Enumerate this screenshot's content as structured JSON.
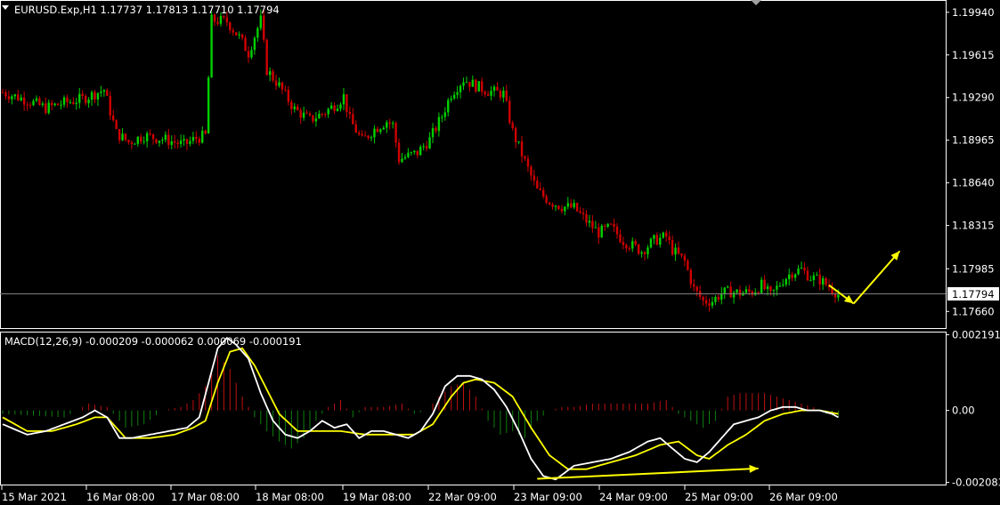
{
  "chart_data": [
    {
      "type": "candlestick",
      "title": "EURUSD.Exp,H1  1.17737 1.17813 1.17710 1.17794",
      "ylim": [
        1.1754,
        1.2002
      ],
      "y_ticks": [
        "1.19940",
        "1.19615",
        "1.19290",
        "1.18965",
        "1.18640",
        "1.18315",
        "1.17985",
        "1.17660"
      ],
      "current_price": "1.17794",
      "bull_color": "#00d000",
      "bear_color": "#d00000",
      "bars": 195,
      "path_anchors": [
        [
          0,
          1.1933
        ],
        [
          8,
          1.1927
        ],
        [
          14,
          1.1921
        ],
        [
          20,
          1.1925
        ],
        [
          26,
          1.1928
        ],
        [
          30,
          1.1932
        ],
        [
          33,
          1.1935
        ],
        [
          37,
          1.1902
        ],
        [
          41,
          1.1895
        ],
        [
          46,
          1.19
        ],
        [
          53,
          1.1897
        ],
        [
          59,
          1.1893
        ],
        [
          63,
          1.1898
        ],
        [
          66,
          1.19
        ],
        [
          68,
          1.1988
        ],
        [
          73,
          1.1987
        ],
        [
          77,
          1.1975
        ],
        [
          80,
          1.1963
        ],
        [
          82,
          1.1976
        ],
        [
          84,
          1.1988
        ],
        [
          86,
          1.195
        ],
        [
          90,
          1.1938
        ],
        [
          95,
          1.192
        ],
        [
          100,
          1.1912
        ],
        [
          105,
          1.1918
        ],
        [
          109,
          1.1925
        ],
        [
          111,
          1.193
        ],
        [
          113,
          1.1912
        ],
        [
          117,
          1.1896
        ],
        [
          121,
          1.1905
        ],
        [
          125,
          1.1911
        ],
        [
          127,
          1.1908
        ],
        [
          129,
          1.1882
        ],
        [
          135,
          1.1887
        ],
        [
          139,
          1.1897
        ],
        [
          143,
          1.1915
        ],
        [
          146,
          1.1932
        ],
        [
          150,
          1.1943
        ],
        [
          154,
          1.1938
        ],
        [
          158,
          1.1934
        ],
        [
          163,
          1.1932
        ],
        [
          166,
          1.1903
        ],
        [
          170,
          1.188
        ],
        [
          174,
          1.1858
        ],
        [
          178,
          1.185
        ],
        [
          182,
          1.1846
        ],
        [
          186,
          1.1845
        ],
        [
          190,
          1.1835
        ],
        [
          194,
          1.1826
        ],
        [
          198,
          1.183
        ],
        [
          202,
          1.182
        ],
        [
          208,
          1.1812
        ],
        [
          212,
          1.182
        ],
        [
          216,
          1.1823
        ],
        [
          218,
          1.1813
        ],
        [
          222,
          1.1804
        ],
        [
          225,
          1.1783
        ],
        [
          228,
          1.1774
        ],
        [
          231,
          1.1774
        ],
        [
          234,
          1.178
        ],
        [
          237,
          1.1781
        ],
        [
          240,
          1.178
        ],
        [
          244,
          1.1781
        ],
        [
          247,
          1.1786
        ],
        [
          250,
          1.1778
        ],
        [
          254,
          1.179
        ],
        [
          257,
          1.1796
        ],
        [
          260,
          1.1798
        ],
        [
          263,
          1.1792
        ],
        [
          266,
          1.179
        ],
        [
          269,
          1.1785
        ],
        [
          272,
          1.1779
        ]
      ],
      "annotation_arrows": [
        {
          "from": [
            1.1786,
            "26 Mar 09:00"
          ],
          "to": [
            1.1772,
            "end"
          ],
          "color": "#ffff00"
        },
        {
          "from": [
            1.1772,
            "end"
          ],
          "to": [
            1.1812,
            "future"
          ],
          "color": "#ffff00"
        }
      ]
    },
    {
      "type": "macd",
      "title": "MACD(12,26,9) -0.000209 -0.000062 0.000069 -0.000191",
      "ylim": [
        -0.00212,
        0.00223
      ],
      "y_ticks": [
        "0.002191",
        "0.00",
        "-0.002083"
      ],
      "macd_color": "#ffffff",
      "signal_color": "#ffff00",
      "hist_pos_color": "#c01010",
      "hist_neg_color": "#108010",
      "histogram_anchors": [
        [
          0,
          -0.0001
        ],
        [
          20,
          -0.0002
        ],
        [
          28,
          0.0002
        ],
        [
          34,
          0.0001
        ],
        [
          40,
          -0.0005
        ],
        [
          46,
          -0.0004
        ],
        [
          52,
          0.0
        ],
        [
          58,
          0.0001
        ],
        [
          62,
          0.0003
        ],
        [
          66,
          0.0007
        ],
        [
          70,
          0.0016
        ],
        [
          74,
          0.0012
        ],
        [
          78,
          0.0004
        ],
        [
          82,
          -0.0002
        ],
        [
          86,
          -0.0006
        ],
        [
          90,
          -0.0009
        ],
        [
          94,
          -0.0011
        ],
        [
          98,
          -0.0008
        ],
        [
          102,
          -0.0003
        ],
        [
          106,
          0.0001
        ],
        [
          110,
          0.0003
        ],
        [
          114,
          -0.0002
        ],
        [
          118,
          0.0001
        ],
        [
          124,
          0.0001
        ],
        [
          130,
          0.0002
        ],
        [
          134,
          -0.0001
        ],
        [
          138,
          0.0
        ],
        [
          142,
          0.0004
        ],
        [
          146,
          0.0007
        ],
        [
          150,
          0.0008
        ],
        [
          154,
          0.0004
        ],
        [
          158,
          -0.0003
        ],
        [
          162,
          -0.0007
        ],
        [
          166,
          -0.0006
        ],
        [
          170,
          -0.0008
        ],
        [
          174,
          -0.0003
        ],
        [
          178,
          0.0
        ],
        [
          182,
          0.0001
        ],
        [
          186,
          0.0001
        ],
        [
          192,
          0.0002
        ],
        [
          198,
          0.0002
        ],
        [
          204,
          0.0002
        ],
        [
          210,
          0.0002
        ],
        [
          216,
          0.0003
        ],
        [
          220,
          -0.0001
        ],
        [
          224,
          -0.0003
        ],
        [
          228,
          -0.0005
        ],
        [
          232,
          -0.0003
        ],
        [
          236,
          0.0004
        ],
        [
          240,
          0.0005
        ],
        [
          244,
          0.0005
        ],
        [
          248,
          0.0005
        ],
        [
          252,
          0.0004
        ],
        [
          256,
          0.0003
        ],
        [
          260,
          0.0002
        ],
        [
          264,
          0.0001
        ],
        [
          268,
          -0.0001
        ],
        [
          272,
          -0.0002
        ]
      ],
      "macd_anchors": [
        [
          0,
          -0.0004
        ],
        [
          8,
          -0.0007
        ],
        [
          14,
          -0.0006
        ],
        [
          20,
          -0.0004
        ],
        [
          26,
          -0.0002
        ],
        [
          30,
          0.0
        ],
        [
          34,
          -0.0002
        ],
        [
          38,
          -0.0008
        ],
        [
          42,
          -0.0008
        ],
        [
          48,
          -0.0007
        ],
        [
          54,
          -0.0006
        ],
        [
          60,
          -0.0005
        ],
        [
          64,
          -0.0002
        ],
        [
          67,
          0.0008
        ],
        [
          70,
          0.0018
        ],
        [
          73,
          0.0021
        ],
        [
          76,
          0.0019
        ],
        [
          80,
          0.0015
        ],
        [
          84,
          0.0005
        ],
        [
          88,
          -0.0003
        ],
        [
          92,
          -0.0007
        ],
        [
          96,
          -0.0008
        ],
        [
          100,
          -0.0006
        ],
        [
          104,
          -0.0003
        ],
        [
          108,
          -0.0005
        ],
        [
          112,
          -0.0004
        ],
        [
          116,
          -0.0008
        ],
        [
          120,
          -0.0006
        ],
        [
          124,
          -0.0006
        ],
        [
          128,
          -0.0007
        ],
        [
          132,
          -0.0008
        ],
        [
          136,
          -0.0006
        ],
        [
          140,
          -0.0001
        ],
        [
          144,
          0.0007
        ],
        [
          148,
          0.001
        ],
        [
          152,
          0.001
        ],
        [
          156,
          0.0009
        ],
        [
          160,
          0.0006
        ],
        [
          164,
          0.0001
        ],
        [
          168,
          -0.0006
        ],
        [
          172,
          -0.0014
        ],
        [
          176,
          -0.0019
        ],
        [
          180,
          -0.002
        ],
        [
          186,
          -0.0016
        ],
        [
          192,
          -0.0015
        ],
        [
          198,
          -0.0014
        ],
        [
          204,
          -0.0012
        ],
        [
          210,
          -0.0009
        ],
        [
          214,
          -0.0008
        ],
        [
          218,
          -0.0011
        ],
        [
          222,
          -0.0014
        ],
        [
          226,
          -0.0015
        ],
        [
          230,
          -0.0012
        ],
        [
          234,
          -0.0008
        ],
        [
          238,
          -0.0004
        ],
        [
          242,
          -0.0003
        ],
        [
          246,
          -0.0002
        ],
        [
          250,
          0.0
        ],
        [
          254,
          0.0001
        ],
        [
          258,
          0.0001
        ],
        [
          262,
          0.0
        ],
        [
          266,
          0.0
        ],
        [
          270,
          -0.0001
        ],
        [
          272,
          -0.0002
        ]
      ],
      "signal_anchors": [
        [
          0,
          -0.0002
        ],
        [
          8,
          -0.0006
        ],
        [
          16,
          -0.0006
        ],
        [
          24,
          -0.0004
        ],
        [
          30,
          -0.0002
        ],
        [
          34,
          -0.0002
        ],
        [
          40,
          -0.0008
        ],
        [
          48,
          -0.0008
        ],
        [
          56,
          -0.0007
        ],
        [
          62,
          -0.0005
        ],
        [
          66,
          -0.0003
        ],
        [
          70,
          0.0008
        ],
        [
          74,
          0.0017
        ],
        [
          78,
          0.0018
        ],
        [
          82,
          0.0013
        ],
        [
          86,
          0.0006
        ],
        [
          90,
          -0.0001
        ],
        [
          96,
          -0.0006
        ],
        [
          102,
          -0.0006
        ],
        [
          110,
          -0.0006
        ],
        [
          118,
          -0.0007
        ],
        [
          126,
          -0.0007
        ],
        [
          134,
          -0.0007
        ],
        [
          140,
          -0.0004
        ],
        [
          146,
          0.0004
        ],
        [
          150,
          0.0008
        ],
        [
          154,
          0.0009
        ],
        [
          160,
          0.0008
        ],
        [
          166,
          0.0004
        ],
        [
          172,
          -0.0005
        ],
        [
          178,
          -0.0013
        ],
        [
          184,
          -0.0017
        ],
        [
          190,
          -0.0017
        ],
        [
          198,
          -0.0015
        ],
        [
          206,
          -0.0013
        ],
        [
          214,
          -0.001
        ],
        [
          220,
          -0.0009
        ],
        [
          226,
          -0.0013
        ],
        [
          230,
          -0.0014
        ],
        [
          236,
          -0.001
        ],
        [
          242,
          -0.0007
        ],
        [
          248,
          -0.0003
        ],
        [
          254,
          -0.0001
        ],
        [
          260,
          0.0
        ],
        [
          266,
          0.0
        ],
        [
          272,
          -0.0001
        ]
      ],
      "annotation_arrows": [
        {
          "from": [
            -0.00195,
            "24 Mar 09:00"
          ],
          "to": [
            -0.00165,
            "26 Mar 09:00"
          ],
          "color": "#ffff00"
        }
      ]
    }
  ],
  "x_axis_labels": [
    "15 Mar 2021",
    "16 Mar 08:00",
    "17 Mar 08:00",
    "18 Mar 08:00",
    "19 Mar 08:00",
    "22 Mar 09:00",
    "23 Mar 09:00",
    "24 Mar 09:00",
    "25 Mar 09:00",
    "26 Mar 09:00"
  ],
  "colors": {
    "background": "#000000",
    "frame": "#ffffff",
    "text": "#ffffff",
    "price_line": "#808080",
    "arrow": "#ffff00"
  }
}
